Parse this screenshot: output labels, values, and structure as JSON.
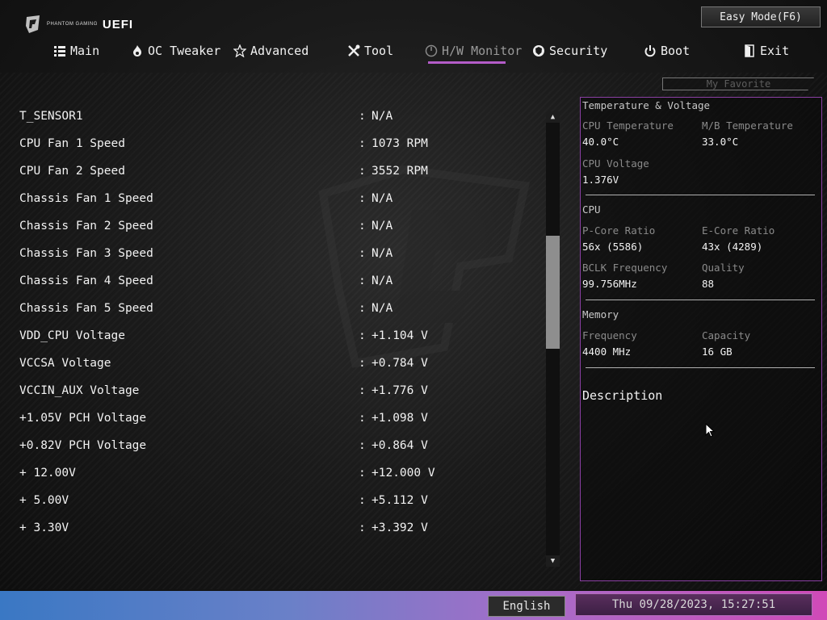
{
  "header": {
    "logo_small": "PHANTOM GAMING",
    "logo_big": "UEFI",
    "easy_mode": "Easy Mode(F6)"
  },
  "tabs": [
    {
      "label": "Main",
      "icon": "list-icon"
    },
    {
      "label": "OC Tweaker",
      "icon": "flame-icon"
    },
    {
      "label": "Advanced",
      "icon": "star-icon"
    },
    {
      "label": "Tool",
      "icon": "tools-icon"
    },
    {
      "label": "H/W Monitor",
      "icon": "monitor-icon",
      "active": true
    },
    {
      "label": "Security",
      "icon": "shield-icon"
    },
    {
      "label": "Boot",
      "icon": "power-icon"
    },
    {
      "label": "Exit",
      "icon": "exit-icon"
    }
  ],
  "my_favorite": "My Favorite",
  "monitor_rows": [
    {
      "label": "T_SENSOR1",
      "value": "N/A"
    },
    {
      "label": "CPU Fan 1 Speed",
      "value": "1073 RPM"
    },
    {
      "label": "CPU Fan 2 Speed",
      "value": "3552 RPM"
    },
    {
      "label": "Chassis Fan 1 Speed",
      "value": "N/A"
    },
    {
      "label": "Chassis Fan 2 Speed",
      "value": "N/A"
    },
    {
      "label": "Chassis Fan 3 Speed",
      "value": "N/A"
    },
    {
      "label": "Chassis Fan 4 Speed",
      "value": "N/A"
    },
    {
      "label": "Chassis Fan 5 Speed",
      "value": "N/A"
    },
    {
      "label": "VDD_CPU Voltage",
      "value": "+1.104 V"
    },
    {
      "label": "VCCSA Voltage",
      "value": "+0.784 V"
    },
    {
      "label": "VCCIN_AUX Voltage",
      "value": "+1.776 V"
    },
    {
      "label": "+1.05V PCH Voltage",
      "value": "+1.098 V"
    },
    {
      "label": "+0.82V PCH Voltage",
      "value": "+0.864 V"
    },
    {
      "label": "+ 12.00V",
      "value": "+12.000 V"
    },
    {
      "label": "+ 5.00V",
      "value": "+5.112 V"
    },
    {
      "label": "+ 3.30V",
      "value": "+3.392 V"
    }
  ],
  "colon": ":",
  "panel": {
    "tv_title": "Temperature & Voltage",
    "cpu_temp_label": "CPU Temperature",
    "cpu_temp": "40.0°C",
    "mb_temp_label": "M/B Temperature",
    "mb_temp": "33.0°C",
    "cpu_volt_label": "CPU Voltage",
    "cpu_volt": "1.376V",
    "cpu_title": "CPU",
    "pcore_label": "P-Core Ratio",
    "pcore": "56x (5586)",
    "ecore_label": "E-Core Ratio",
    "ecore": "43x (4289)",
    "bclk_label": "BCLK Frequency",
    "bclk": "99.756MHz",
    "quality_label": "Quality",
    "quality": "88",
    "mem_title": "Memory",
    "freq_label": "Frequency",
    "freq": "4400 MHz",
    "cap_label": "Capacity",
    "cap": "16 GB",
    "description": "Description"
  },
  "footer": {
    "language": "English",
    "datetime": "Thu 09/28/2023, 15:27:51"
  },
  "colors": {
    "accent": "#b45cc8",
    "panel_border": "#8a3fa3"
  }
}
